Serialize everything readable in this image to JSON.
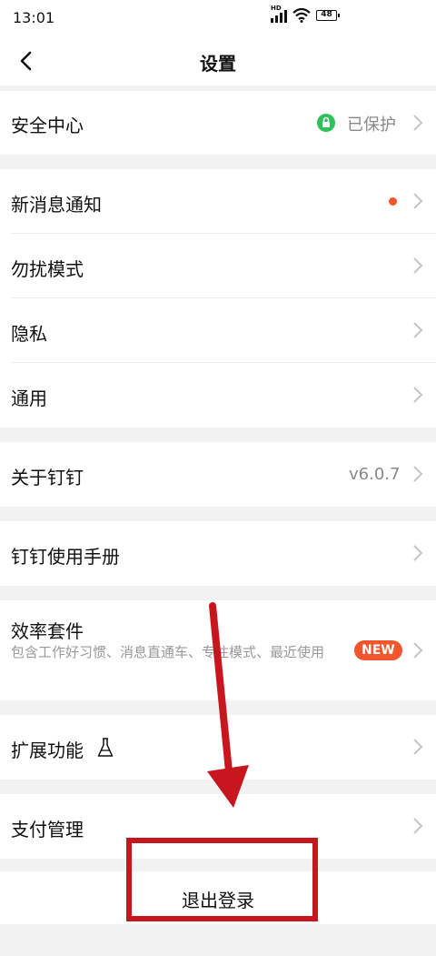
{
  "status_bar": {
    "time": "13:01",
    "signal_label": "HD",
    "battery": "48"
  },
  "header": {
    "title": "设置"
  },
  "rows": {
    "security": {
      "label": "安全中心",
      "value": "已保护"
    },
    "notify": {
      "label": "新消息通知"
    },
    "dnd": {
      "label": "勿扰模式"
    },
    "privacy": {
      "label": "隐私"
    },
    "general": {
      "label": "通用"
    },
    "about": {
      "label": "关于钉钉",
      "value": "v6.0.7"
    },
    "manual": {
      "label": "钉钉使用手册"
    },
    "efficiency": {
      "label": "效率套件",
      "subtitle": "包含工作好习惯、消息直通车、专注模式、最近使用",
      "badge": "NEW"
    },
    "extensions": {
      "label": "扩展功能"
    },
    "payment": {
      "label": "支付管理"
    }
  },
  "logout": {
    "label": "退出登录"
  },
  "colors": {
    "accent_red": "#c8161e",
    "badge_orange": "#f0552b",
    "lock_green": "#2fc25b",
    "annotation_arrow": "#c8161e"
  },
  "icons": [
    "back-icon",
    "lock-icon",
    "chevron-right-icon",
    "flask-icon",
    "signal-icon",
    "wifi-icon",
    "battery-icon"
  ]
}
